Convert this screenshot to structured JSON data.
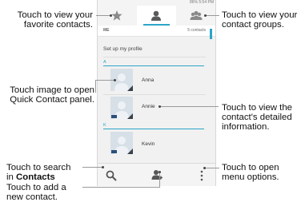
{
  "callouts": {
    "favorites": [
      "Touch to view your",
      "favorite contacts."
    ],
    "groups": [
      "Touch to view your",
      "contact groups."
    ],
    "quick_contact": [
      "Touch image to open",
      "Quick Contact panel."
    ],
    "details": [
      "Touch to view the",
      "contact's detailed",
      "information."
    ],
    "search_line1": "Touch to search",
    "search_line2_prefix": "in ",
    "search_line2_bold": "Contacts",
    "add": [
      "Touch to add a",
      "new contact."
    ],
    "menu": [
      "Touch to open",
      "menu options."
    ]
  },
  "phone": {
    "status": {
      "battery": "86%",
      "time": "5:54 PM"
    },
    "tabs": [
      {
        "icon": "star-icon",
        "active": false
      },
      {
        "icon": "person-icon",
        "active": true
      },
      {
        "icon": "group-icon",
        "active": false
      }
    ],
    "me_label": "ME",
    "contact_count": "5 contacts",
    "setup_profile": "Set up my profile",
    "sections": [
      "A",
      "K"
    ],
    "contacts": [
      "Anna",
      "Annie",
      "Kevin"
    ],
    "bottom_icons": [
      "search-icon",
      "add-contact-icon",
      "overflow-menu-icon"
    ],
    "accent_color": "#2aa5c8"
  }
}
